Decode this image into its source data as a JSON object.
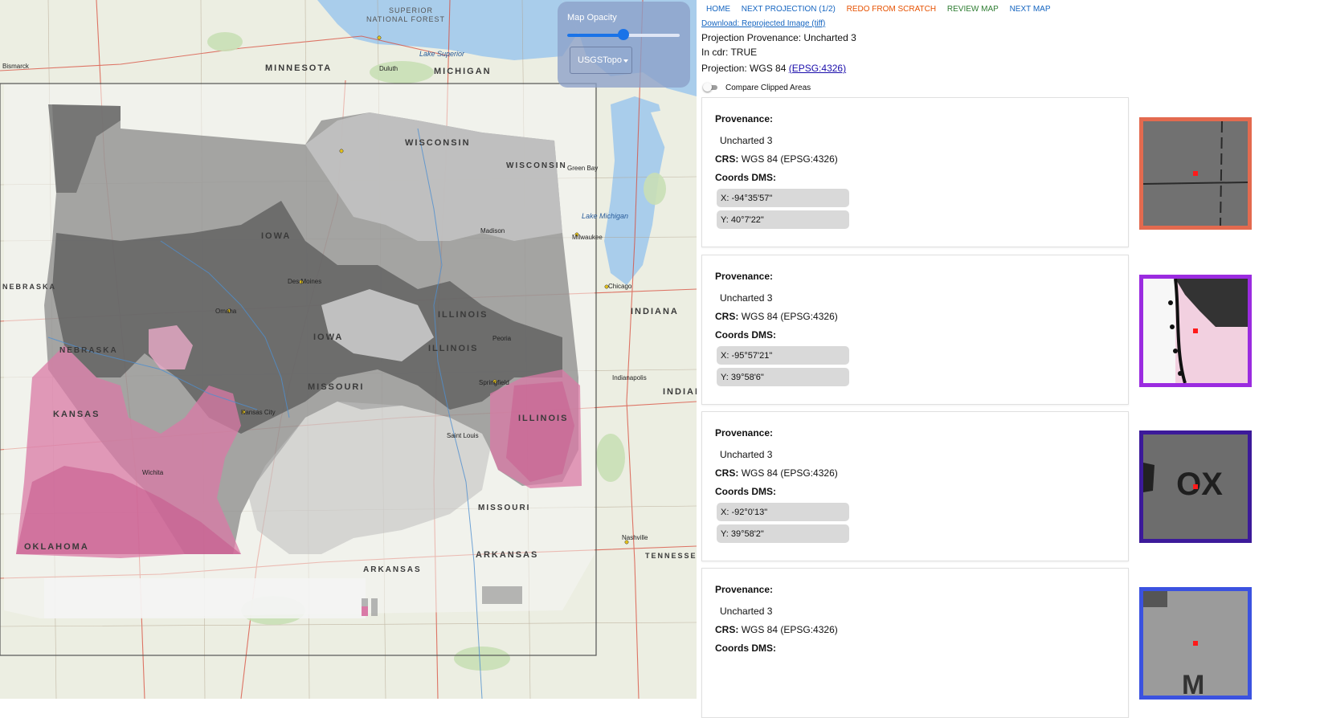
{
  "map": {
    "labels": {
      "superior_nf": "SUPERIOR",
      "national_forest": "NATIONAL FOREST",
      "minnesota": "MINNESOTA",
      "michigan": "MICHIGAN",
      "wisconsin": "WISCONSIN",
      "iowa": "IOWA",
      "illinois": "ILLINOIS",
      "indiana": "INDIANA",
      "missouri": "MISSOURI",
      "kansas": "KANSAS",
      "nebraska": "NEBRASKA",
      "oklahoma": "OKLAHOMA",
      "arkansas": "ARKANSAS",
      "tennessee": "TENNESSEE",
      "lake_superior": "Lake Superior",
      "lake_michigan": "Lake Michigan",
      "chicago": "Chicago",
      "milwaukee": "Milwaukee",
      "des_moines": "Des Moines",
      "omaha": "Omaha",
      "kansas_city": "Kansas City",
      "springfield": "Springfield",
      "nashville": "Nashville",
      "bismarck": "Bismarck",
      "duluth": "Duluth",
      "indianapolis": "Indianapolis",
      "st_louis": "Saint Louis",
      "peoria": "Peoria",
      "wichita": "Wichita",
      "madison": "Madison",
      "green_bay": "Green Bay"
    },
    "controls": {
      "opacity_label": "Map Opacity",
      "opacity_value": 0.5,
      "basemap_selected": "USGSTopo"
    }
  },
  "nav": {
    "home": "HOME",
    "next_projection": "NEXT PROJECTION (1/2)",
    "redo": "REDO FROM SCRATCH",
    "review": "REVIEW MAP",
    "next_map": "NEXT MAP"
  },
  "download_link": "Download: Reprojected Image (tiff)",
  "projection_provenance": "Projection Provenance: Uncharted 3",
  "in_cdr": "In cdr: TRUE",
  "projection_prefix": "Projection: WGS 84",
  "projection_epsg": "(EPSG:4326)",
  "compare_label": "Compare Clipped Areas",
  "cards": [
    {
      "prov_label": "Provenance:",
      "prov_value": "Uncharted 3",
      "crs_label": "CRS:",
      "crs_value": "WGS 84 (EPSG:4326)",
      "coords_label": "Coords DMS:",
      "x": "X: -94°35'57\"",
      "y": "Y: 40°7'22\"",
      "thumb_color": "#e36a4f"
    },
    {
      "prov_label": "Provenance:",
      "prov_value": "Uncharted 3",
      "crs_label": "CRS:",
      "crs_value": "WGS 84 (EPSG:4326)",
      "coords_label": "Coords DMS:",
      "x": "X: -95°57'21\"",
      "y": "Y: 39°58'6\"",
      "thumb_color": "#9b2be0"
    },
    {
      "prov_label": "Provenance:",
      "prov_value": "Uncharted 3",
      "crs_label": "CRS:",
      "crs_value": "WGS 84 (EPSG:4326)",
      "coords_label": "Coords DMS:",
      "x": "X: -92°0'13\"",
      "y": "Y: 39°58'2\"",
      "thumb_color": "#3c1a9a"
    },
    {
      "prov_label": "Provenance:",
      "prov_value": "Uncharted 3",
      "crs_label": "CRS:",
      "crs_value": "WGS 84 (EPSG:4326)",
      "coords_label": "Coords DMS:",
      "x": "",
      "y": "",
      "thumb_color": "#3b52e0"
    }
  ],
  "thumb_texts": {
    "third": "OX",
    "fourth": "M"
  }
}
